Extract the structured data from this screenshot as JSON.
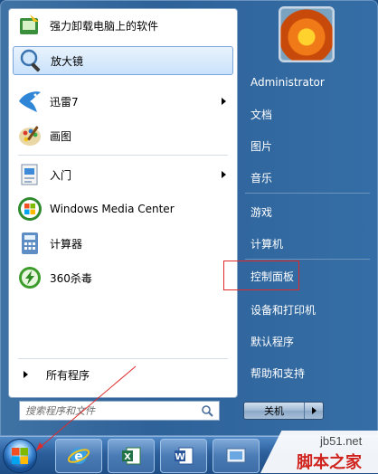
{
  "programs": [
    {
      "label": "强力卸载电脑上的软件",
      "icon": "uninstall-tool-icon",
      "has_arrow": false
    },
    {
      "label": "放大镜",
      "icon": "magnifier-icon",
      "has_arrow": false
    },
    {
      "label": "迅雷7",
      "icon": "thunder-bird-icon",
      "has_arrow": true
    },
    {
      "label": "画图",
      "icon": "paint-palette-icon",
      "has_arrow": false
    },
    {
      "label": "入门",
      "icon": "getting-started-icon",
      "has_arrow": true
    },
    {
      "label": "Windows Media Center",
      "icon": "windows-logo-icon",
      "has_arrow": false
    },
    {
      "label": "计算器",
      "icon": "calculator-icon",
      "has_arrow": false
    },
    {
      "label": "360杀毒",
      "icon": "antivirus-360-icon",
      "has_arrow": false
    }
  ],
  "all_programs": "所有程序",
  "search": {
    "placeholder": "搜索程序和文件"
  },
  "right": {
    "user": "Administrator",
    "items": [
      "文档",
      "图片",
      "音乐",
      "游戏",
      "计算机",
      "控制面板",
      "设备和打印机",
      "默认程序",
      "帮助和支持"
    ]
  },
  "shutdown": {
    "label": "关机"
  },
  "highlighted_item": "控制面板",
  "taskbar": {
    "apps": [
      "internet-explorer-icon",
      "excel-icon",
      "word-icon",
      "control-panel-icon"
    ]
  },
  "watermark": {
    "site": "jb51.net",
    "brand": "脚本之家"
  },
  "colors": {
    "highlight_border": "#e02a2a",
    "menu_blue": "#2e6299"
  }
}
